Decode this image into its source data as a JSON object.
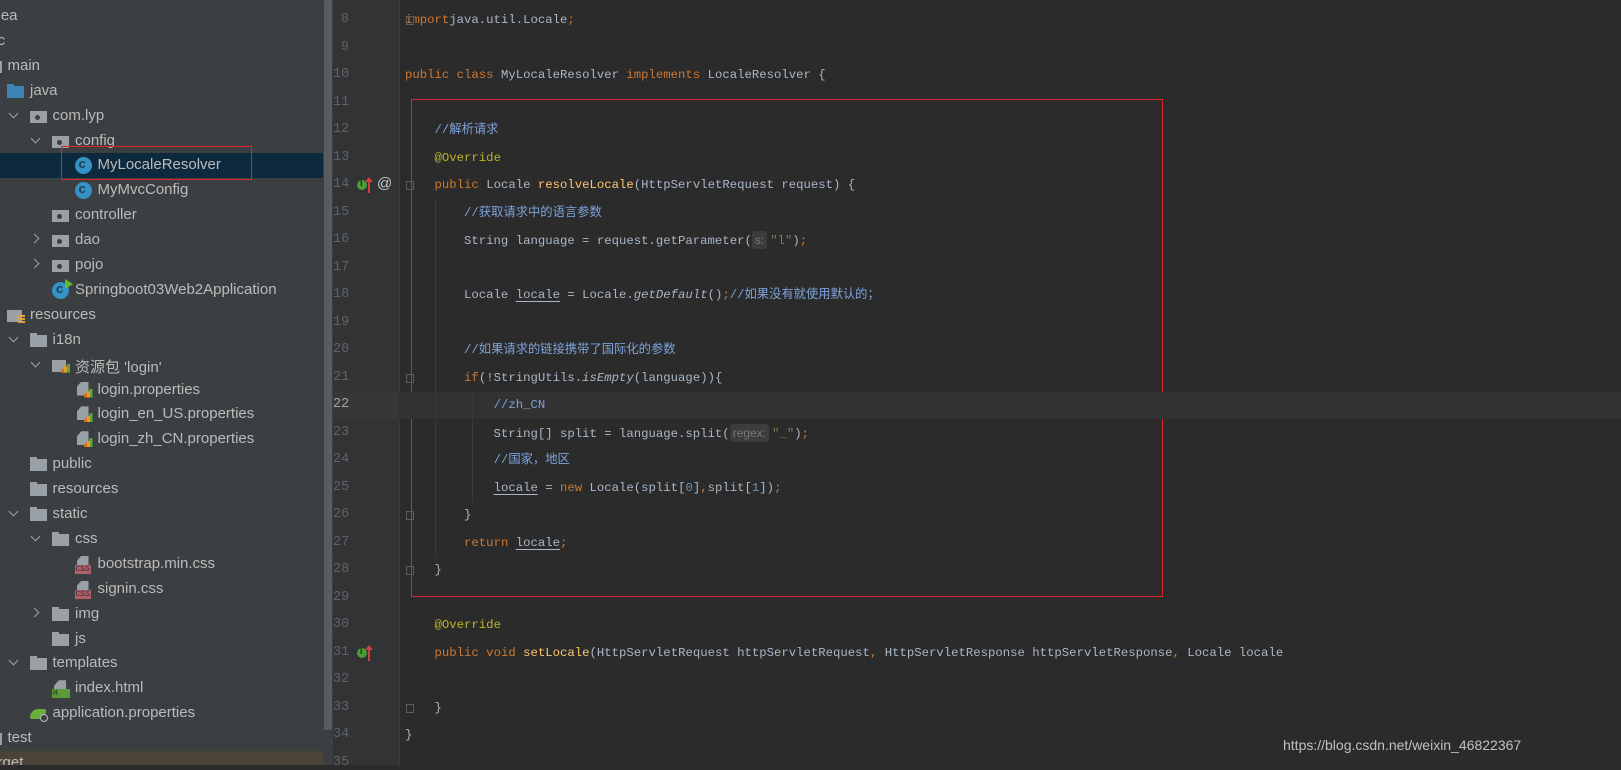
{
  "project_tree": {
    "items": [
      {
        "label": ".idea",
        "level": -2,
        "arrow": null,
        "icon": "folder"
      },
      {
        "label": "src",
        "level": -2,
        "arrow": null,
        "icon": "folder"
      },
      {
        "label": "main",
        "level": -1,
        "arrow": null,
        "icon": "folder"
      },
      {
        "label": "java",
        "level": 0,
        "arrow": null,
        "icon": "src"
      },
      {
        "label": "com.lyp",
        "level": 1,
        "arrow": "open",
        "icon": "pkg"
      },
      {
        "label": "config",
        "level": 2,
        "arrow": "open",
        "icon": "pkg"
      },
      {
        "label": "MyLocaleResolver",
        "level": 3,
        "arrow": null,
        "icon": "cls",
        "selected": true
      },
      {
        "label": "MyMvcConfig",
        "level": 3,
        "arrow": null,
        "icon": "cls"
      },
      {
        "label": "controller",
        "level": 2,
        "arrow": null,
        "icon": "pkg"
      },
      {
        "label": "dao",
        "level": 2,
        "arrow": "closed",
        "icon": "pkg"
      },
      {
        "label": "pojo",
        "level": 2,
        "arrow": "closed",
        "icon": "pkg"
      },
      {
        "label": "Springboot03Web2Application",
        "level": 2,
        "arrow": null,
        "icon": "boot"
      },
      {
        "label": "resources",
        "level": 0,
        "arrow": null,
        "icon": "res"
      },
      {
        "label": "i18n",
        "level": 1,
        "arrow": "open",
        "icon": "folder"
      },
      {
        "label": "资源包 'login'",
        "level": 2,
        "arrow": "open",
        "icon": "bundle"
      },
      {
        "label": "login.properties",
        "level": 3,
        "arrow": null,
        "icon": "prop"
      },
      {
        "label": "login_en_US.properties",
        "level": 3,
        "arrow": null,
        "icon": "prop"
      },
      {
        "label": "login_zh_CN.properties",
        "level": 3,
        "arrow": null,
        "icon": "prop"
      },
      {
        "label": "public",
        "level": 1,
        "arrow": null,
        "icon": "folder"
      },
      {
        "label": "resources",
        "level": 1,
        "arrow": null,
        "icon": "folder"
      },
      {
        "label": "static",
        "level": 1,
        "arrow": "open",
        "icon": "folder"
      },
      {
        "label": "css",
        "level": 2,
        "arrow": "open",
        "icon": "folder"
      },
      {
        "label": "bootstrap.min.css",
        "level": 3,
        "arrow": null,
        "icon": "css"
      },
      {
        "label": "signin.css",
        "level": 3,
        "arrow": null,
        "icon": "css"
      },
      {
        "label": "img",
        "level": 2,
        "arrow": "closed",
        "icon": "folder"
      },
      {
        "label": "js",
        "level": 2,
        "arrow": null,
        "icon": "folder"
      },
      {
        "label": "templates",
        "level": 1,
        "arrow": "open",
        "icon": "folder"
      },
      {
        "label": "index.html",
        "level": 2,
        "arrow": null,
        "icon": "html"
      },
      {
        "label": "application.properties",
        "level": 1,
        "arrow": null,
        "icon": "spring"
      },
      {
        "label": "test",
        "level": -1,
        "arrow": null,
        "icon": "folder"
      },
      {
        "label": "target",
        "level": -2,
        "arrow": null,
        "icon": "folder",
        "excluded": true
      }
    ]
  },
  "editor": {
    "current_line": 22,
    "highlight_color": "#e0252a",
    "lines": [
      {
        "n": 8,
        "tokens": [
          [
            "kw",
            "import"
          ],
          [
            "",
            "java.util.Locale"
          ],
          [
            "kw",
            ";"
          ]
        ]
      },
      {
        "n": 9,
        "tokens": []
      },
      {
        "n": 10,
        "tokens": [
          [
            "kw",
            "public class "
          ],
          [
            "",
            "MyLocaleResolver "
          ],
          [
            "kw",
            "implements "
          ],
          [
            "",
            "LocaleResolver {"
          ]
        ]
      },
      {
        "n": 11,
        "tokens": []
      },
      {
        "n": 12,
        "tokens": [
          [
            "",
            "    "
          ],
          [
            "cm",
            "//解析请求"
          ]
        ]
      },
      {
        "n": 13,
        "tokens": [
          [
            "",
            "    "
          ],
          [
            "an",
            "@Override"
          ]
        ]
      },
      {
        "n": 14,
        "tokens": [
          [
            "",
            "    "
          ],
          [
            "kw",
            "public "
          ],
          [
            "",
            "Locale "
          ],
          [
            "fn",
            "resolveLocale"
          ],
          [
            "",
            "(HttpServletRequest request) {"
          ]
        ]
      },
      {
        "n": 15,
        "tokens": [
          [
            "",
            "        "
          ],
          [
            "cm",
            "//获取请求中的语言参数"
          ]
        ]
      },
      {
        "n": 16,
        "tokens": [
          [
            "",
            "        String language = request.getParameter("
          ],
          [
            "hint",
            "s:"
          ],
          [
            "st",
            "\"l\""
          ],
          [
            "",
            ")"
          ],
          [
            "kw",
            ";"
          ]
        ]
      },
      {
        "n": 17,
        "tokens": []
      },
      {
        "n": 18,
        "tokens": [
          [
            "",
            "        Locale "
          ],
          [
            "ul",
            "locale"
          ],
          [
            "",
            " = Locale."
          ],
          [
            "it",
            "getDefault"
          ],
          [
            "",
            "()"
          ],
          [
            "kw",
            ";"
          ],
          [
            "cm",
            "//如果没有就使用默认的；"
          ]
        ]
      },
      {
        "n": 19,
        "tokens": []
      },
      {
        "n": 20,
        "tokens": [
          [
            "",
            "        "
          ],
          [
            "cm",
            "//如果请求的链接携带了国际化的参数"
          ]
        ]
      },
      {
        "n": 21,
        "tokens": [
          [
            "",
            "        "
          ],
          [
            "kw",
            "if"
          ],
          [
            "",
            "(!StringUtils."
          ],
          [
            "it",
            "isEmpty"
          ],
          [
            "",
            "(language)){"
          ]
        ]
      },
      {
        "n": 22,
        "tokens": [
          [
            "",
            "            "
          ],
          [
            "cm",
            "//zh_CN"
          ]
        ]
      },
      {
        "n": 23,
        "tokens": [
          [
            "",
            "            String[] split = language.split("
          ],
          [
            "hint",
            "regex:"
          ],
          [
            "st",
            "\"_\""
          ],
          [
            "",
            ")"
          ],
          [
            "kw",
            ";"
          ]
        ]
      },
      {
        "n": 24,
        "tokens": [
          [
            "",
            "            "
          ],
          [
            "cm",
            "//国家，地区"
          ]
        ]
      },
      {
        "n": 25,
        "tokens": [
          [
            "",
            "            "
          ],
          [
            "ul",
            "locale"
          ],
          [
            "",
            " = "
          ],
          [
            "kw",
            "new "
          ],
          [
            "",
            "Locale(split["
          ],
          [
            "nu",
            "0"
          ],
          [
            "",
            "]"
          ],
          [
            "kw",
            ","
          ],
          [
            "",
            "split["
          ],
          [
            "nu",
            "1"
          ],
          [
            "",
            "])"
          ],
          [
            "kw",
            ";"
          ]
        ]
      },
      {
        "n": 26,
        "tokens": [
          [
            "",
            "        }"
          ]
        ]
      },
      {
        "n": 27,
        "tokens": [
          [
            "",
            "        "
          ],
          [
            "kw",
            "return "
          ],
          [
            "ul",
            "locale"
          ],
          [
            "kw",
            ";"
          ]
        ]
      },
      {
        "n": 28,
        "tokens": [
          [
            "",
            "    }"
          ]
        ]
      },
      {
        "n": 29,
        "tokens": []
      },
      {
        "n": 30,
        "tokens": [
          [
            "",
            "    "
          ],
          [
            "an",
            "@Override"
          ]
        ]
      },
      {
        "n": 31,
        "tokens": [
          [
            "",
            "    "
          ],
          [
            "kw",
            "public void "
          ],
          [
            "fn",
            "setLocale"
          ],
          [
            "",
            "(HttpServletRequest httpServletRequest"
          ],
          [
            "kw",
            ", "
          ],
          [
            "",
            "HttpServletResponse httpServletResponse"
          ],
          [
            "kw",
            ", "
          ],
          [
            "",
            "Locale locale"
          ]
        ]
      },
      {
        "n": 32,
        "tokens": []
      },
      {
        "n": 33,
        "tokens": [
          [
            "",
            "    }"
          ]
        ]
      },
      {
        "n": 34,
        "tokens": [
          [
            "",
            "}"
          ]
        ]
      },
      {
        "n": 35,
        "tokens": []
      }
    ],
    "gutter_icons": [
      {
        "line": 14,
        "icons": [
          "implements-icon",
          "override-arrow-icon",
          "at-annotation-icon"
        ]
      },
      {
        "line": 31,
        "icons": [
          "implements-icon",
          "override-arrow-icon"
        ]
      }
    ],
    "fold_lines": [
      8,
      14,
      21,
      26,
      28,
      33
    ]
  },
  "watermark": "https://blog.csdn.net/weixin_46822367"
}
